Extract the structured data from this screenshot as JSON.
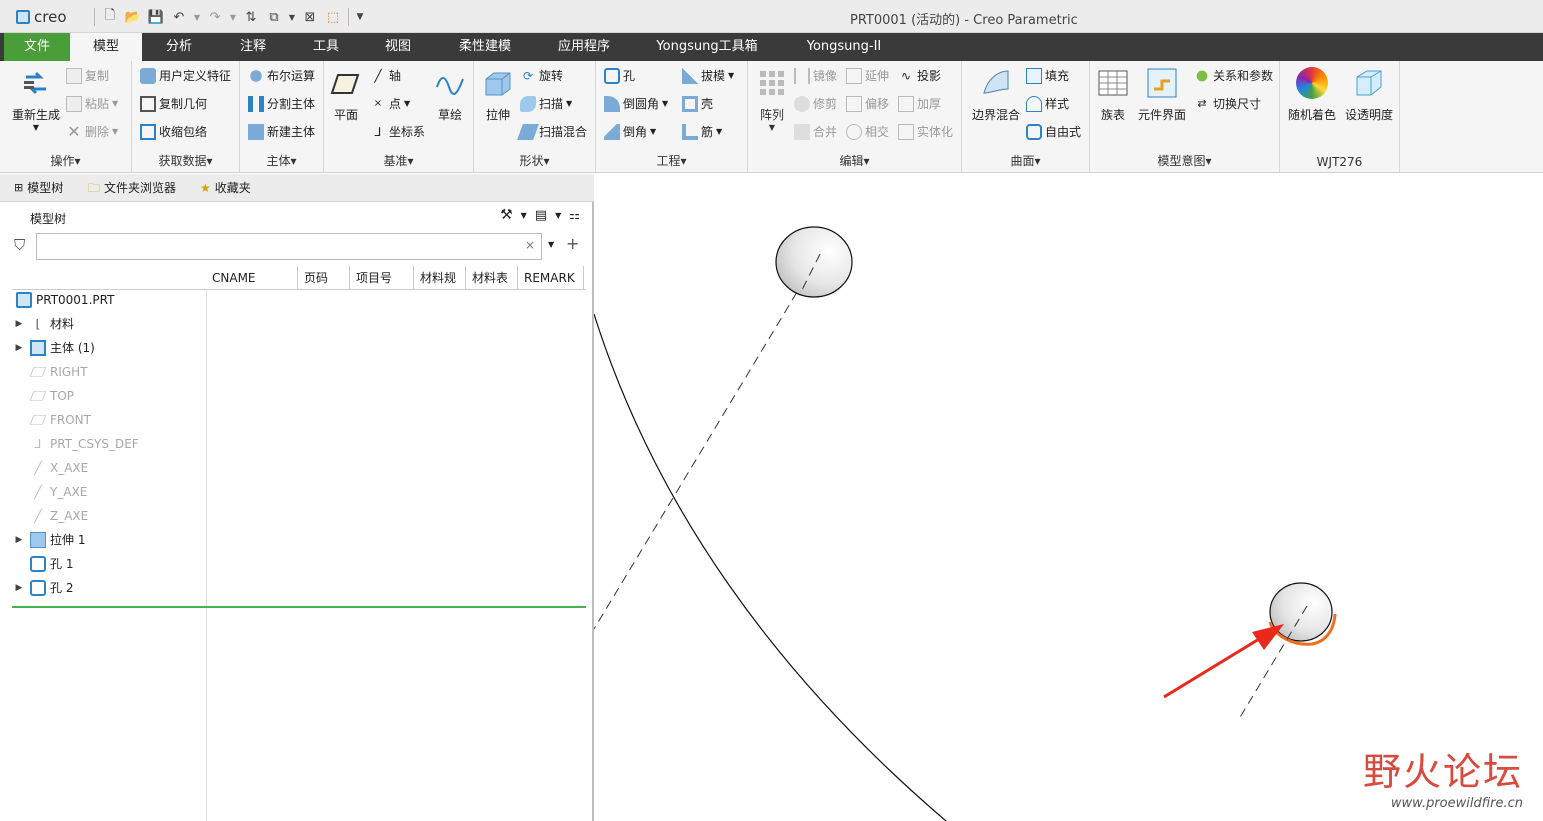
{
  "app": {
    "logo_text": "creo",
    "window_title": "PRT0001 (活动的) - Creo Parametric"
  },
  "tabs": [
    "文件",
    "模型",
    "分析",
    "注释",
    "工具",
    "视图",
    "柔性建模",
    "应用程序",
    "Yongsung工具箱",
    "Yongsung-II"
  ],
  "ribbon": {
    "groups": {
      "operations": "操作",
      "get_data": "获取数据",
      "body": "主体",
      "datum": "基准",
      "shapes": "形状",
      "engineering": "工程",
      "editing": "编辑",
      "surfaces": "曲面",
      "model_intent": "模型意图",
      "wjt": "WJT276"
    },
    "items": {
      "regenerate": "重新生成",
      "copy": "复制",
      "paste": "粘贴",
      "delete": "删除",
      "udf": "用户定义特征",
      "copy_geom": "复制几何",
      "shrinkwrap": "收缩包络",
      "boolean": "布尔运算",
      "split_body": "分割主体",
      "new_body": "新建主体",
      "plane": "平面",
      "axis": "轴",
      "point": "点",
      "csys": "坐标系",
      "sketch": "草绘",
      "extrude": "拉伸",
      "revolve": "旋转",
      "sweep": "扫描",
      "swept_blend": "扫描混合",
      "hole": "孔",
      "round": "倒圆角",
      "chamfer": "倒角",
      "draft": "拔模",
      "shell": "壳",
      "rib": "筋",
      "pattern": "阵列",
      "mirror": "镜像",
      "trim": "修剪",
      "merge": "合并",
      "extend": "延伸",
      "offset": "偏移",
      "intersect": "相交",
      "project": "投影",
      "thicken": "加厚",
      "solidify": "实体化",
      "boundary_blend": "边界混合",
      "fill": "填充",
      "style": "样式",
      "freestyle": "自由式",
      "family_table": "族表",
      "component_interface": "元件界面",
      "relations": "关系和参数",
      "switch_dims": "切换尺寸",
      "random_color": "随机着色",
      "set_transparency": "设透明度"
    }
  },
  "navigator": {
    "tabs": [
      "模型树",
      "文件夹浏览器",
      "收藏夹"
    ],
    "tree_header": "模型树",
    "filter_value": "",
    "columns": [
      "CNAME",
      "页码",
      "项目号",
      "材料规",
      "材料表",
      "REMARK"
    ],
    "rows": [
      {
        "label": "PRT0001.PRT",
        "expand": "",
        "grey": false
      },
      {
        "label": "材料",
        "expand": "▶",
        "grey": false
      },
      {
        "label": "主体 (1)",
        "expand": "▶",
        "grey": false
      },
      {
        "label": "RIGHT",
        "expand": "",
        "grey": true
      },
      {
        "label": "TOP",
        "expand": "",
        "grey": true
      },
      {
        "label": "FRONT",
        "expand": "",
        "grey": true
      },
      {
        "label": "PRT_CSYS_DEF",
        "expand": "",
        "grey": true
      },
      {
        "label": "X_AXE",
        "expand": "",
        "grey": true
      },
      {
        "label": "Y_AXE",
        "expand": "",
        "grey": true
      },
      {
        "label": "Z_AXE",
        "expand": "",
        "grey": true
      },
      {
        "label": "拉伸 1",
        "expand": "▶",
        "grey": false
      },
      {
        "label": "孔 1",
        "expand": "",
        "grey": false
      },
      {
        "label": "孔 2",
        "expand": "▶",
        "grey": false
      }
    ]
  },
  "watermark": {
    "title": "野火论坛",
    "url": "www.proewildfire.cn"
  },
  "colors": {
    "file_tab": "#4a9e3a",
    "tab_bar": "#3a3a3a",
    "highlight_edge": "#f07020",
    "arrow": "#e8291c",
    "accent": "#2b83c6"
  }
}
